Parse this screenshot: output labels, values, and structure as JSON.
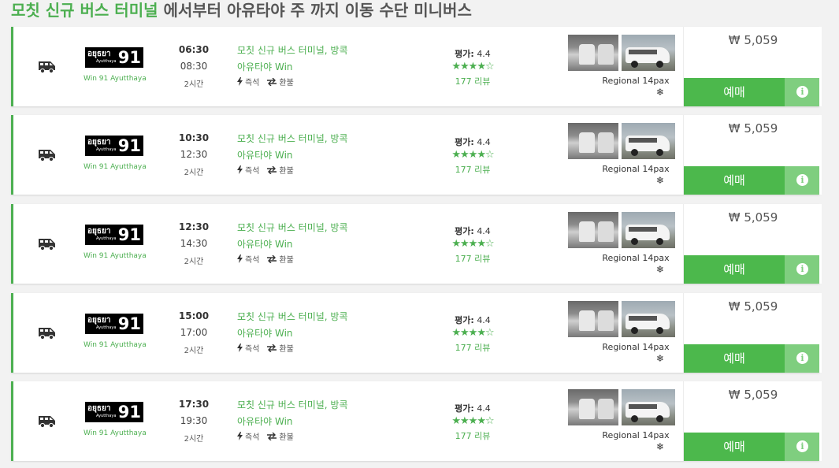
{
  "heading": {
    "highlight": "모칫 신규 버스 터미널",
    "rest": " 에서부터 아유타야 주 까지 이동 수단 미니버스"
  },
  "colors": {
    "accent": "#4caf50",
    "book_button": "#4cb84c",
    "info_button": "#7fce7f"
  },
  "icons": {
    "vehicle": "minibus-icon",
    "instant": "lightning-icon",
    "refund": "swap-arrows-icon",
    "aircon": "snowflake-icon",
    "info": "info-icon"
  },
  "trips": [
    {
      "logo_thai": "อยุธยา",
      "logo_sub": "Ayutthaya",
      "logo_num": "91",
      "operator": "Win 91 Ayutthaya",
      "dep": "06:30",
      "arr": "08:30",
      "dur": "2시간",
      "from": "모칫 신규 버스 터미널, 방콕",
      "to": "아유타야 Win",
      "feat_instant": "즉석",
      "feat_refund": "환불",
      "rating_label": "평가:",
      "rating": "4.4",
      "stars": "★★★★☆",
      "reviews": "177 리뷰",
      "vehicle": "Regional 14pax",
      "ac": "❄",
      "price": "₩ 5,059",
      "book": "예매",
      "info": "i"
    },
    {
      "logo_thai": "อยุธยา",
      "logo_sub": "Ayutthaya",
      "logo_num": "91",
      "operator": "Win 91 Ayutthaya",
      "dep": "10:30",
      "arr": "12:30",
      "dur": "2시간",
      "from": "모칫 신규 버스 터미널, 방콕",
      "to": "아유타야 Win",
      "feat_instant": "즉석",
      "feat_refund": "환불",
      "rating_label": "평가:",
      "rating": "4.4",
      "stars": "★★★★☆",
      "reviews": "177 리뷰",
      "vehicle": "Regional 14pax",
      "ac": "❄",
      "price": "₩ 5,059",
      "book": "예매",
      "info": "i"
    },
    {
      "logo_thai": "อยุธยา",
      "logo_sub": "Ayutthaya",
      "logo_num": "91",
      "operator": "Win 91 Ayutthaya",
      "dep": "12:30",
      "arr": "14:30",
      "dur": "2시간",
      "from": "모칫 신규 버스 터미널, 방콕",
      "to": "아유타야 Win",
      "feat_instant": "즉석",
      "feat_refund": "환불",
      "rating_label": "평가:",
      "rating": "4.4",
      "stars": "★★★★☆",
      "reviews": "177 리뷰",
      "vehicle": "Regional 14pax",
      "ac": "❄",
      "price": "₩ 5,059",
      "book": "예매",
      "info": "i"
    },
    {
      "logo_thai": "อยุธยา",
      "logo_sub": "Ayutthaya",
      "logo_num": "91",
      "operator": "Win 91 Ayutthaya",
      "dep": "15:00",
      "arr": "17:00",
      "dur": "2시간",
      "from": "모칫 신규 버스 터미널, 방콕",
      "to": "아유타야 Win",
      "feat_instant": "즉석",
      "feat_refund": "환불",
      "rating_label": "평가:",
      "rating": "4.4",
      "stars": "★★★★☆",
      "reviews": "177 리뷰",
      "vehicle": "Regional 14pax",
      "ac": "❄",
      "price": "₩ 5,059",
      "book": "예매",
      "info": "i"
    },
    {
      "logo_thai": "อยุธยา",
      "logo_sub": "Ayutthaya",
      "logo_num": "91",
      "operator": "Win 91 Ayutthaya",
      "dep": "17:30",
      "arr": "19:30",
      "dur": "2시간",
      "from": "모칫 신규 버스 터미널, 방콕",
      "to": "아유타야 Win",
      "feat_instant": "즉석",
      "feat_refund": "환불",
      "rating_label": "평가:",
      "rating": "4.4",
      "stars": "★★★★☆",
      "reviews": "177 리뷰",
      "vehicle": "Regional 14pax",
      "ac": "❄",
      "price": "₩ 5,059",
      "book": "예매",
      "info": "i"
    }
  ]
}
